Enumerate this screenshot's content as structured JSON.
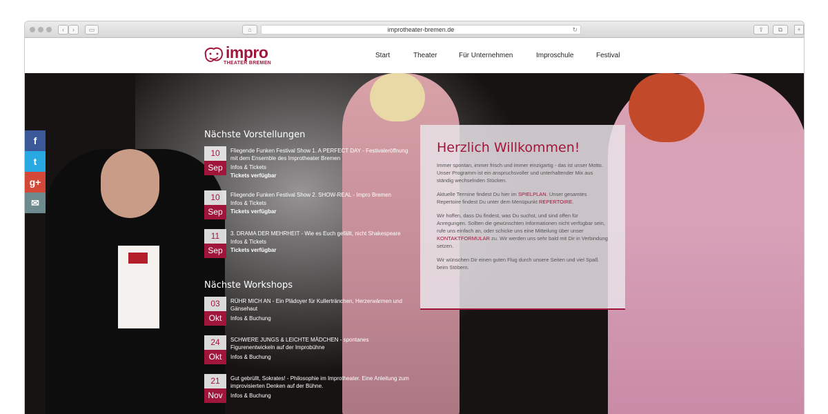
{
  "browser": {
    "url": "improtheater-bremen.de"
  },
  "logo": {
    "word": "impro",
    "sub": "THEATER BREMEN"
  },
  "nav": [
    {
      "label": "Start"
    },
    {
      "label": "Theater"
    },
    {
      "label": "Für Unternehmen"
    },
    {
      "label": "Improschule"
    },
    {
      "label": "Festival"
    }
  ],
  "social": [
    {
      "icon": "facebook-icon",
      "glyph": "f",
      "color": "#3b5998"
    },
    {
      "icon": "twitter-icon",
      "glyph": "t",
      "color": "#29a9e1"
    },
    {
      "icon": "google-plus-icon",
      "glyph": "g+",
      "color": "#d34836"
    },
    {
      "icon": "mail-icon",
      "glyph": "✉",
      "color": "#6d8b8f"
    }
  ],
  "shows": {
    "title": "Nächste Vorstellungen",
    "items": [
      {
        "day": "10",
        "month": "Sep",
        "title": "Fliegende Funken Festival Show 1. A PERFECT DAY - Festivaleröffnung mit dem Ensemble des Improtheater Bremen",
        "info": "Infos & Tickets",
        "tickets": "Tickets verfügbar"
      },
      {
        "day": "10",
        "month": "Sep",
        "title": "Fliegende Funken Festival Show 2. SHOW-REAL - Impro Bremen",
        "info": "Infos & Tickets",
        "tickets": "Tickets verfügbar"
      },
      {
        "day": "11",
        "month": "Sep",
        "title": "3. DRAMA DER MEHRHEIT - Wie es Euch gefällt, nicht Shakespeare",
        "info": "Infos & Tickets",
        "tickets": "Tickets verfügbar"
      }
    ]
  },
  "workshops": {
    "title": "Nächste Workshops",
    "items": [
      {
        "day": "03",
        "month": "Okt",
        "title": "RÜHR MICH AN - Ein Plädoyer für Kullertränchen, Herzerwärmen und Gänsehaut",
        "info": "Infos & Buchung"
      },
      {
        "day": "24",
        "month": "Okt",
        "title": "SCHWERE JUNGS & LEICHTE MÄDCHEN - spontanes Figurenentwickeln auf der Improbühne",
        "info": "Infos & Buchung"
      },
      {
        "day": "21",
        "month": "Nov",
        "title": "Gut gebrüllt, Sokrates! - Philosophie im Improtheater. Eine Anleitung zum improvisierten Denken auf der Bühne.",
        "info": "Infos & Buchung"
      }
    ]
  },
  "welcome": {
    "title": "Herzlich Willkommen!",
    "p1": "Immer spontan, immer frisch und immer einzigartig - das ist unser Motto. Unser Programm ist ein anspruchsvoller und unterhaltender Mix aus ständig wechselnden Stücken.",
    "p2a": "Aktuelle Termine findest Du hier im ",
    "p2link1": "SPIELPLAN",
    "p2b": ". Unser gesamtes Repertoire findest Du unter dem Menüpunkt ",
    "p2link2": "REPERTOIRE",
    "p2c": ".",
    "p3a": "Wir hoffen, dass Du findest, was Du suchst, und sind offen für Anregungen. Sollten die gewünschten Informationen nicht verfügbar sein, rufe uns einfach an, oder schicke uns eine Mitteilung über unser ",
    "p3link": "KONTAKTFORMULAR",
    "p3b": " zu. Wir werden uns sehr bald mit Dir in Verbindung setzen.",
    "p4": "Wir wünschen Dir einen guten Flug durch unsere Seiten und viel Spaß beim Stöbern."
  },
  "colors": {
    "accent": "#a0163b"
  }
}
